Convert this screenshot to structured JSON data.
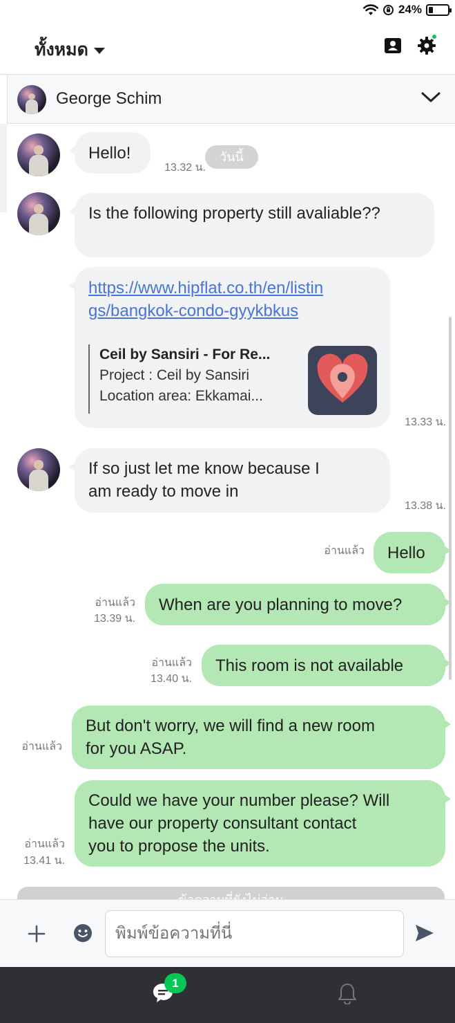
{
  "status_bar": {
    "battery": "24%",
    "battery_level": 0.24
  },
  "header": {
    "filter_label": "ทั้งหมด"
  },
  "chat": {
    "contact_name": "George Schim"
  },
  "date_divider": "วันนี้",
  "messages": {
    "m1": {
      "text": "Hello!",
      "time": "13.32 น."
    },
    "m2": {
      "text": "Is the following property still avaliable??"
    },
    "m3": {
      "url_line1": "https://www.hipflat.co.th/en/listin",
      "url_line2": "gs/bangkok-condo-gyykbkus",
      "preview_title": "Ceil by Sansiri - For Re...",
      "preview_line1": "Project : Ceil by Sansiri",
      "preview_line2": "Location area: Ekkamai...",
      "time": "13.33 น."
    },
    "m4": {
      "line1": "If so just let me know because I",
      "line2": "am ready to move in",
      "time": "13.38 น."
    },
    "m5": {
      "text": "Hello",
      "read": "อ่านแล้ว"
    },
    "m6": {
      "text": "When are you planning to move?",
      "read": "อ่านแล้ว",
      "time": "13.39 น."
    },
    "m7": {
      "text": "This room is not available",
      "read": "อ่านแล้ว",
      "time": "13.40 น."
    },
    "m8": {
      "line1": "But don't worry, we will find a new room",
      "line2": "for you ASAP.",
      "read": "อ่านแล้ว"
    },
    "m9": {
      "line1": "Could we have your number please? Will",
      "line2": "have our property consultant contact",
      "line3": "you to propose the units.",
      "read": "อ่านแล้ว",
      "time": "13.41 น."
    }
  },
  "unread_divider": "ข้อความที่ยังไม่อ่าน",
  "composer": {
    "placeholder": "พิมพ์ข้อความที่นี่"
  },
  "bottom_nav": {
    "chat_badge": "1"
  },
  "colors": {
    "accent_green": "#06c755",
    "outgoing_bubble": "#b3e7b3",
    "incoming_bubble": "#f1f2f4",
    "link": "#4a73d8"
  }
}
